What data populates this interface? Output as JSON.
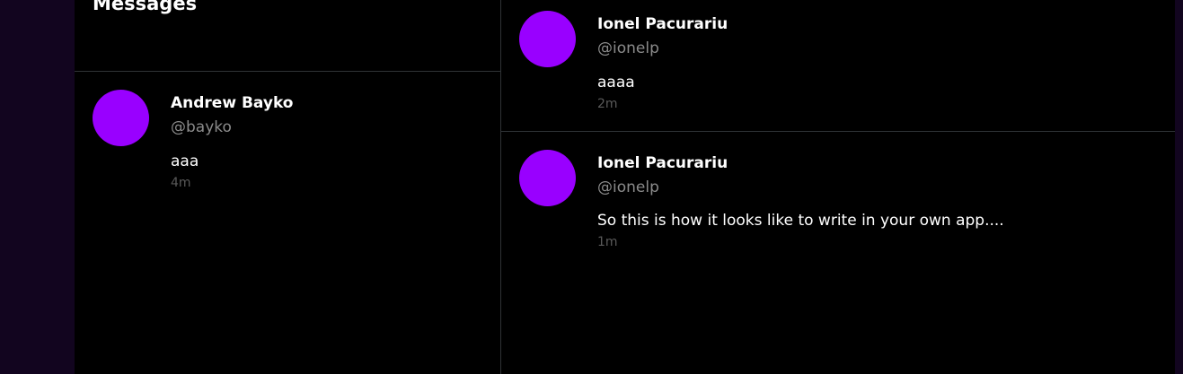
{
  "sidebar_panel": {
    "title": "Messages"
  },
  "conversations": [
    {
      "name": "Andrew Bayko",
      "handle": "@bayko",
      "text": "aaa",
      "time": "4m"
    }
  ],
  "thread": [
    {
      "name": "Ionel Pacurariu",
      "handle": "@ionelp",
      "text": "aaaa",
      "time": "2m"
    },
    {
      "name": "Ionel Pacurariu",
      "handle": "@ionelp",
      "text": "So this is how it looks like to write in your own app....",
      "time": "1m"
    }
  ],
  "colors": {
    "avatar": "#9900ff",
    "background": "#000000",
    "outer_background": "#12051f",
    "divider": "#2f3336"
  }
}
